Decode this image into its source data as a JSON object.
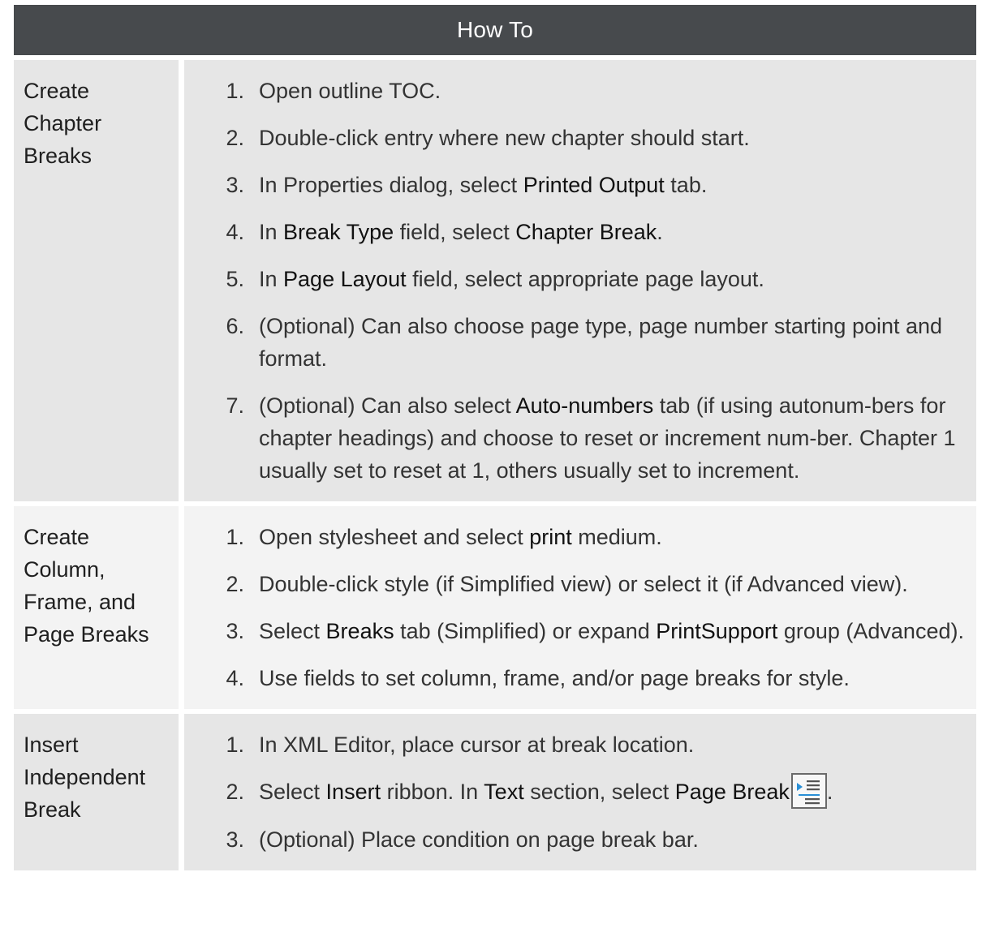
{
  "header": {
    "title": "How To"
  },
  "rows": [
    {
      "label": "Create Chapter Breaks",
      "steps": [
        {
          "num": "1.",
          "parts": [
            "Open outline TOC."
          ]
        },
        {
          "num": "2.",
          "parts": [
            "Double-click entry where new chapter should start."
          ]
        },
        {
          "num": "3.",
          "parts": [
            "In Properties dialog, select ",
            "Printed Output",
            " tab."
          ]
        },
        {
          "num": "4.",
          "parts": [
            "In ",
            "Break Type",
            " field, select ",
            "Chapter Break",
            "."
          ]
        },
        {
          "num": "5.",
          "parts": [
            "In ",
            "Page Layout",
            " field, select appropriate page layout."
          ]
        },
        {
          "num": "6.",
          "parts": [
            "(Optional) Can also choose page type, page number starting point and format."
          ]
        },
        {
          "num": "7.",
          "parts": [
            "(Optional) Can also select ",
            "Auto-numbers",
            " tab (if using autonum-bers for chapter headings) and choose to reset or increment num-ber. Chapter 1 usually set to reset at 1, others usually set to increment."
          ]
        }
      ]
    },
    {
      "label": "Create Column, Frame, and Page Breaks",
      "steps": [
        {
          "num": "1.",
          "parts": [
            "Open stylesheet and select ",
            "print",
            " medium."
          ]
        },
        {
          "num": "2.",
          "parts": [
            "Double-click style (if Simplified view) or select it (if Advanced view)."
          ]
        },
        {
          "num": "3.",
          "parts": [
            "Select ",
            "Breaks",
            " tab (Simplified) or expand ",
            "PrintSupport",
            " group (Advanced)."
          ]
        },
        {
          "num": "4.",
          "parts": [
            "Use fields to set column, frame, and/or page breaks for style."
          ]
        }
      ]
    },
    {
      "label": "Insert Independent Break",
      "steps": [
        {
          "num": "1.",
          "parts": [
            "In XML Editor, place cursor at break location."
          ]
        },
        {
          "num": "2.",
          "parts": [
            "Select ",
            "Insert",
            " ribbon. In ",
            "Text",
            " section, select ",
            "Page Break",
            "."
          ]
        },
        {
          "num": "3.",
          "parts": [
            "(Optional) Place condition on page break bar."
          ]
        }
      ]
    }
  ]
}
